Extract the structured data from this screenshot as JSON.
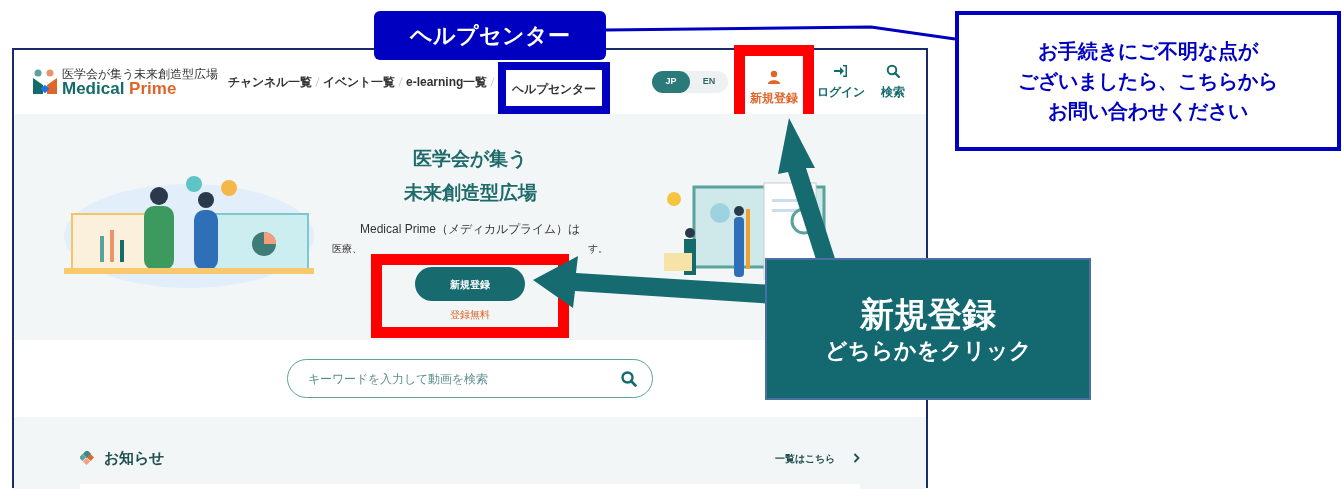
{
  "header": {
    "logo": {
      "tagline": "医学会が集う未来創造型広場",
      "name_first": "Medical",
      "name_second": "Prime"
    },
    "nav": [
      {
        "label": "チャンネル一覧",
        "highlighted": false
      },
      {
        "label": "イベント一覧",
        "highlighted": false
      },
      {
        "label": "e-learning一覧",
        "highlighted": false
      },
      {
        "label": "ヘルプセンター",
        "highlighted": true
      }
    ],
    "languages": [
      {
        "label": "JP",
        "selected": true
      },
      {
        "label": "EN",
        "selected": false
      }
    ],
    "actions": [
      {
        "kind": "register",
        "label": "新規登録",
        "color": "#e0652a"
      },
      {
        "kind": "login",
        "label": "ログイン",
        "color": "#156b6b"
      },
      {
        "kind": "search",
        "label": "検索",
        "color": "#156b6b"
      }
    ]
  },
  "hero": {
    "headline": [
      "医学会が集う",
      "未来創造型広場"
    ],
    "description_line_1": "Medical Prime（メディカルプライム）は",
    "description_line_2_start": "医療、",
    "description_line_2_end": "す。",
    "button": "新規登録",
    "note": "登録無料"
  },
  "search": {
    "placeholder": "キーワードを入力して動画を検索"
  },
  "news": {
    "title": "お知らせ",
    "link": "一覧はこちら"
  },
  "annotations": {
    "help_label": "ヘルプセンター",
    "help_note": [
      "お手続きにご不明な点が",
      "ございましたら、こちらから",
      "お問い合わせください"
    ],
    "callout_title": "新規登録",
    "callout_subtitle": "どちらかをクリック"
  }
}
